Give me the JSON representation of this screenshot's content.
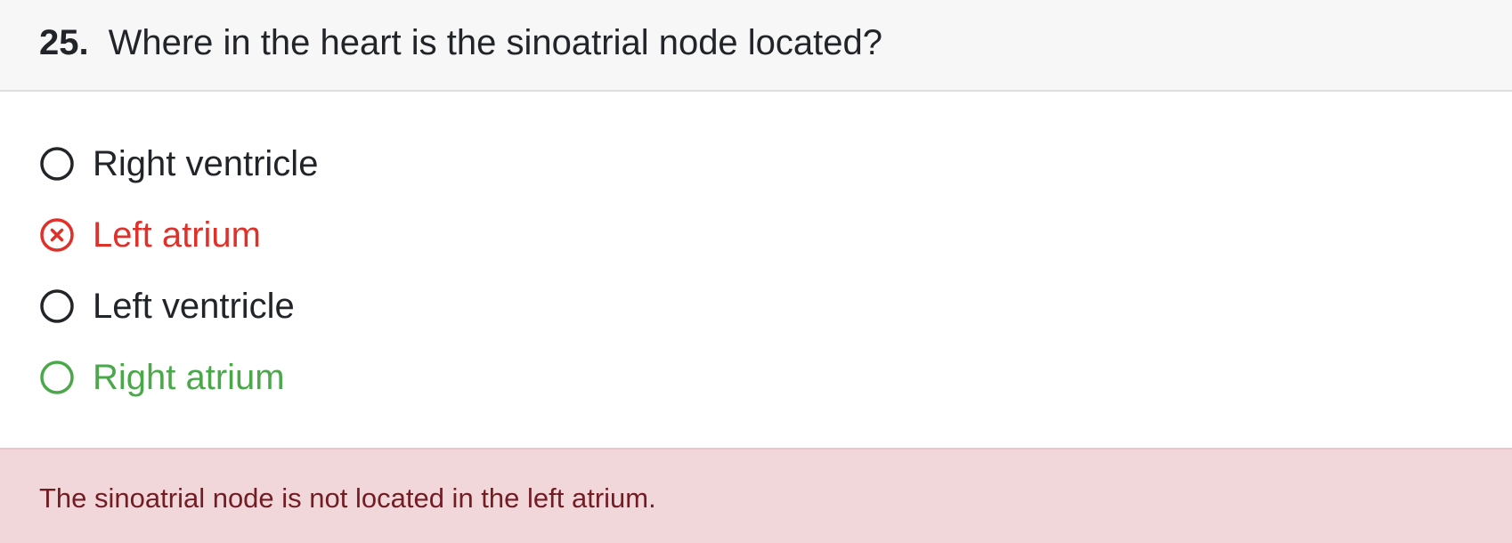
{
  "question": {
    "number": "25.",
    "text": "Where in the heart is the sinoatrial node located?"
  },
  "options": [
    {
      "label": "Right ventricle",
      "state": "unselected"
    },
    {
      "label": "Left atrium",
      "state": "selected-incorrect"
    },
    {
      "label": "Left ventricle",
      "state": "unselected"
    },
    {
      "label": "Right atrium",
      "state": "correct"
    }
  ],
  "feedback": {
    "text": "The sinoatrial node is not located in the left atrium."
  },
  "colors": {
    "text": "#212529",
    "incorrect": "#e0302a",
    "correct": "#4aa84a",
    "header_bg": "#f7f7f7",
    "feedback_bg": "#f2d7da",
    "feedback_text": "#721c24"
  },
  "icons": {
    "unselected": "radio-empty-icon",
    "incorrect": "x-circle-icon",
    "correct": "radio-correct-icon"
  }
}
